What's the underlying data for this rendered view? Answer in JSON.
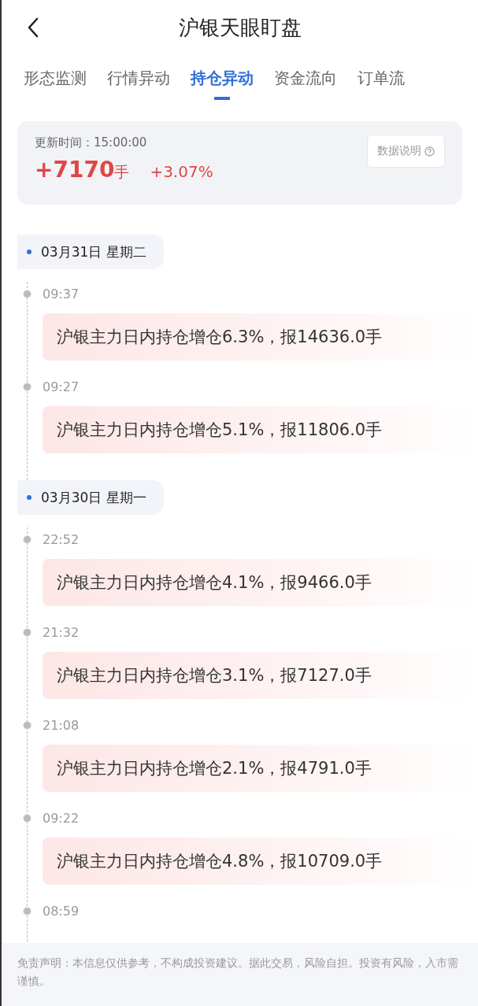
{
  "header": {
    "title": "沪银天眼盯盘"
  },
  "tabs": [
    {
      "label": "形态监测",
      "selected": false
    },
    {
      "label": "行情异动",
      "selected": false
    },
    {
      "label": "持仓异动",
      "selected": true
    },
    {
      "label": "资金流向",
      "selected": false
    },
    {
      "label": "订单流",
      "selected": false
    }
  ],
  "summary": {
    "update_label": "更新时间：15:00:00",
    "change_value": "+7170",
    "change_unit": "手",
    "change_percent": "+3.07%",
    "info_button": "数据说明"
  },
  "days": [
    {
      "date": "03月31日 星期二",
      "events": [
        {
          "time": "09:37",
          "text": "沪银主力日内持仓增仓6.3%，报14636.0手"
        },
        {
          "time": "09:27",
          "text": "沪银主力日内持仓增仓5.1%，报11806.0手"
        }
      ]
    },
    {
      "date": "03月30日 星期一",
      "events": [
        {
          "time": "22:52",
          "text": "沪银主力日内持仓增仓4.1%，报9466.0手"
        },
        {
          "time": "21:32",
          "text": "沪银主力日内持仓增仓3.1%，报7127.0手"
        },
        {
          "time": "21:08",
          "text": "沪银主力日内持仓增仓2.1%，报4791.0手"
        },
        {
          "time": "09:22",
          "text": "沪银主力日内持仓增仓4.8%，报10709.0手"
        },
        {
          "time": "08:59"
        }
      ]
    }
  ],
  "disclaimer": "免责声明：本信息仅供参考，不构成投资建议。据此交易，风险自担。投资有风险，入市需谨慎。"
}
